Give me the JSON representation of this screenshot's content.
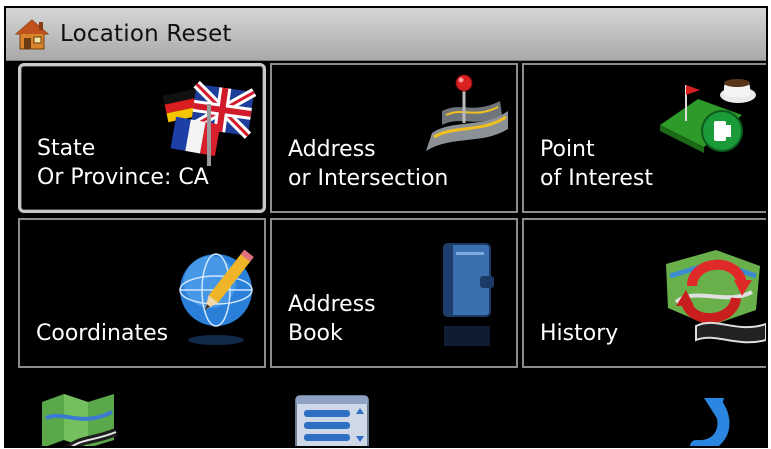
{
  "header": {
    "title": "Location Reset",
    "icon": "house-icon"
  },
  "tiles": [
    {
      "line1": "State",
      "line2": "Or Province: CA",
      "icon": "flags-icon"
    },
    {
      "line1": "Address",
      "line2": "or Intersection",
      "icon": "road-pin-icon"
    },
    {
      "line1": "Point",
      "line2": "of Interest",
      "icon": "poi-golf-fuel-icon"
    },
    {
      "line1": "",
      "line2": "Coordinates",
      "icon": "globe-pencil-icon"
    },
    {
      "line1": "Address",
      "line2": "Book",
      "icon": "address-book-icon"
    },
    {
      "line1": "",
      "line2": "History",
      "icon": "history-arrows-icon"
    }
  ],
  "bottom": {
    "map_button_icon": "map-icon",
    "menu_button_icon": "list-menu-icon",
    "back_button_icon": "back-arrow-icon"
  },
  "colors": {
    "background": "#000000",
    "titlebar": "#c4c4c4",
    "tile_border": "#8c8c8c",
    "text": "#ffffff"
  }
}
